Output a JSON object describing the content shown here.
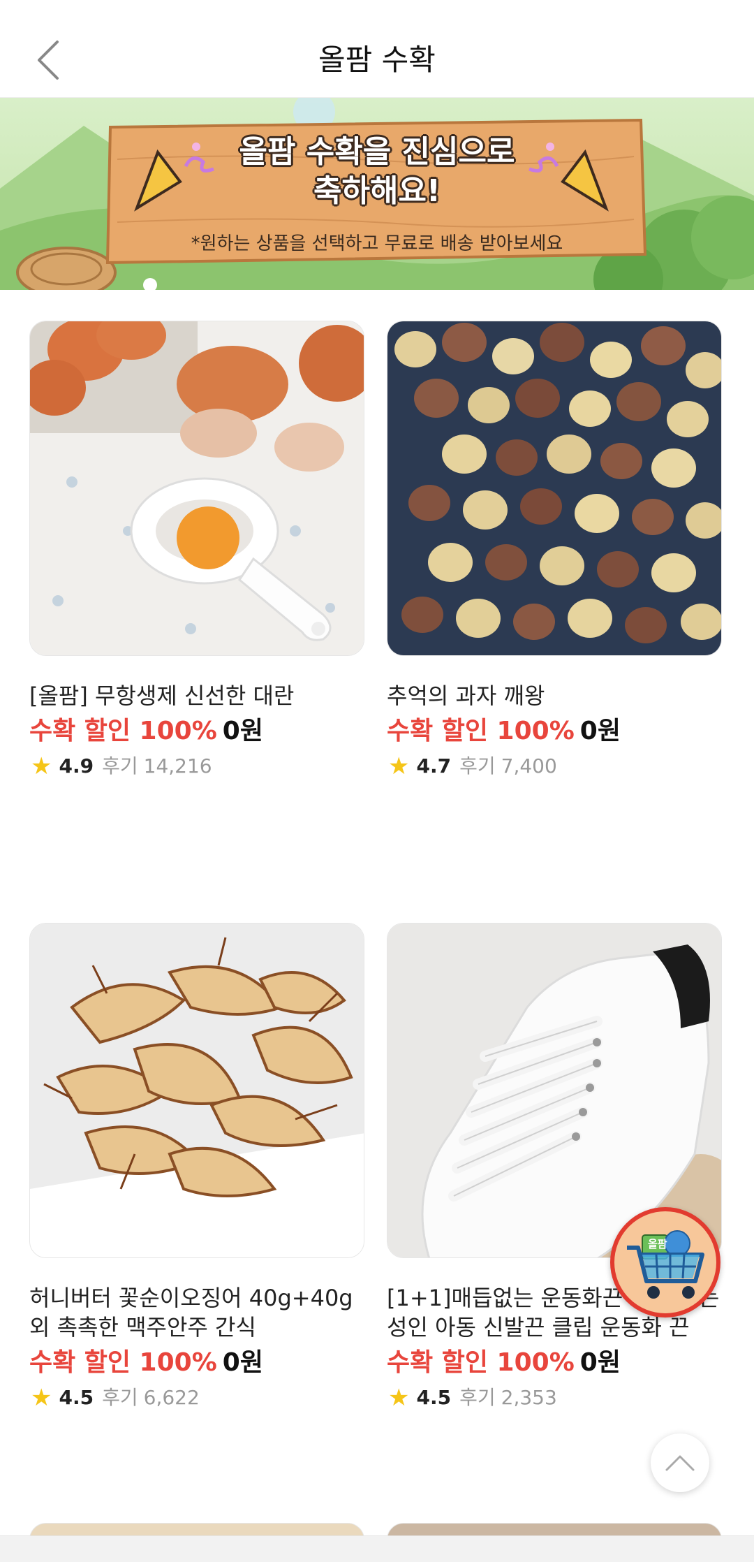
{
  "header": {
    "title": "올팜 수확",
    "back_icon": "chevron-left-icon"
  },
  "banner": {
    "title_line1": "올팜 수확을 진심으로",
    "title_line2": "축하해요!",
    "subtitle": "*원하는 상품을 선택하고 무료로 배송 받아보세요"
  },
  "products": [
    {
      "name": "[올팜] 무항생제 신선한 대란",
      "discount_label": "수확 할인 100%",
      "price": "0원",
      "rating": "4.9",
      "review_label": "후기",
      "review_count": "14,216"
    },
    {
      "name": "추억의 과자 깨왕",
      "discount_label": "수확 할인 100%",
      "price": "0원",
      "rating": "4.7",
      "review_label": "후기",
      "review_count": "7,400"
    },
    {
      "name": "허니버터 꽃순이오징어 40g+40g 외 촉촉한 맥주안주 간식",
      "discount_label": "수확 할인 100%",
      "price": "0원",
      "rating": "4.5",
      "review_label": "후기",
      "review_count": "6,622"
    },
    {
      "name": "[1+1]매듭없는 운동화끈 묶지 않는 성인 아동 신발끈 클립 운동화 끈",
      "discount_label": "수확 할인 100%",
      "price": "0원",
      "rating": "4.5",
      "review_label": "후기",
      "review_count": "2,353"
    }
  ],
  "floating": {
    "cart_icon": "cart-icon",
    "cart_badge": "올팜",
    "top_icon": "chevron-up-icon"
  },
  "colors": {
    "discount": "#e8453c",
    "star": "#f5c518",
    "fab_border": "#e23b2f"
  }
}
